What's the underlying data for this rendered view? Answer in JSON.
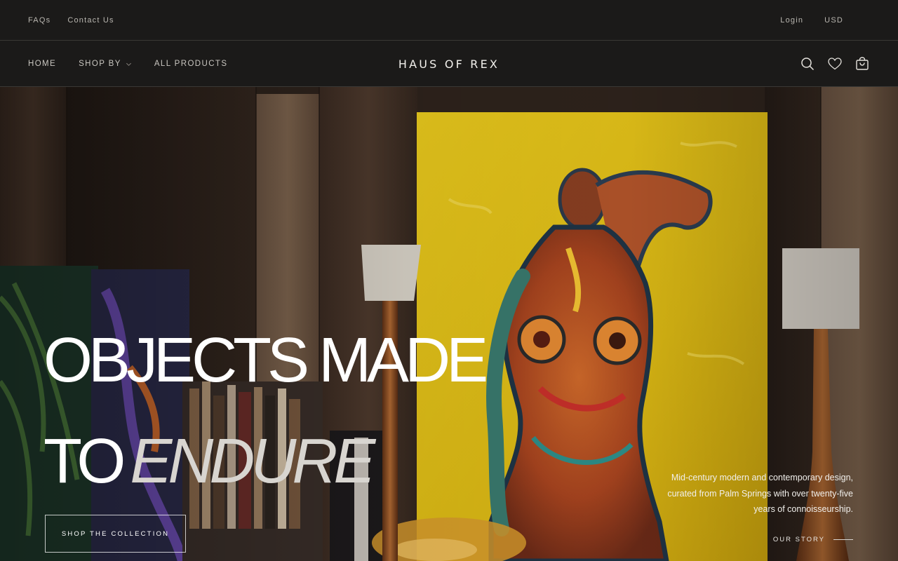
{
  "utility": {
    "faqs": "FAQs",
    "contact": "Contact Us",
    "login": "Login",
    "currency": "USD"
  },
  "nav": {
    "home": "HOME",
    "shop_by": "SHOP BY",
    "all_products": "ALL PRODUCTS"
  },
  "brand": {
    "name": "HAUS OF REX"
  },
  "header_icons": [
    "search-icon",
    "wishlist-heart-icon",
    "cart-bag-icon"
  ],
  "hero": {
    "headline_line1": "OBJECTS MADE",
    "headline_line2_plain": "TO",
    "headline_line2_accent": "ENDURE",
    "cta": "SHOP THE COLLECTION",
    "copy": "Mid-century modern and contemporary design, curated from Palm Springs with over twenty-five years of connoisseurship.",
    "story_link": "OUR STORY"
  },
  "colors": {
    "header_bg": "#1b1a19",
    "border": "#3a3835",
    "canvas_yellow": "#e6c51c",
    "text_light": "#ffffff"
  }
}
